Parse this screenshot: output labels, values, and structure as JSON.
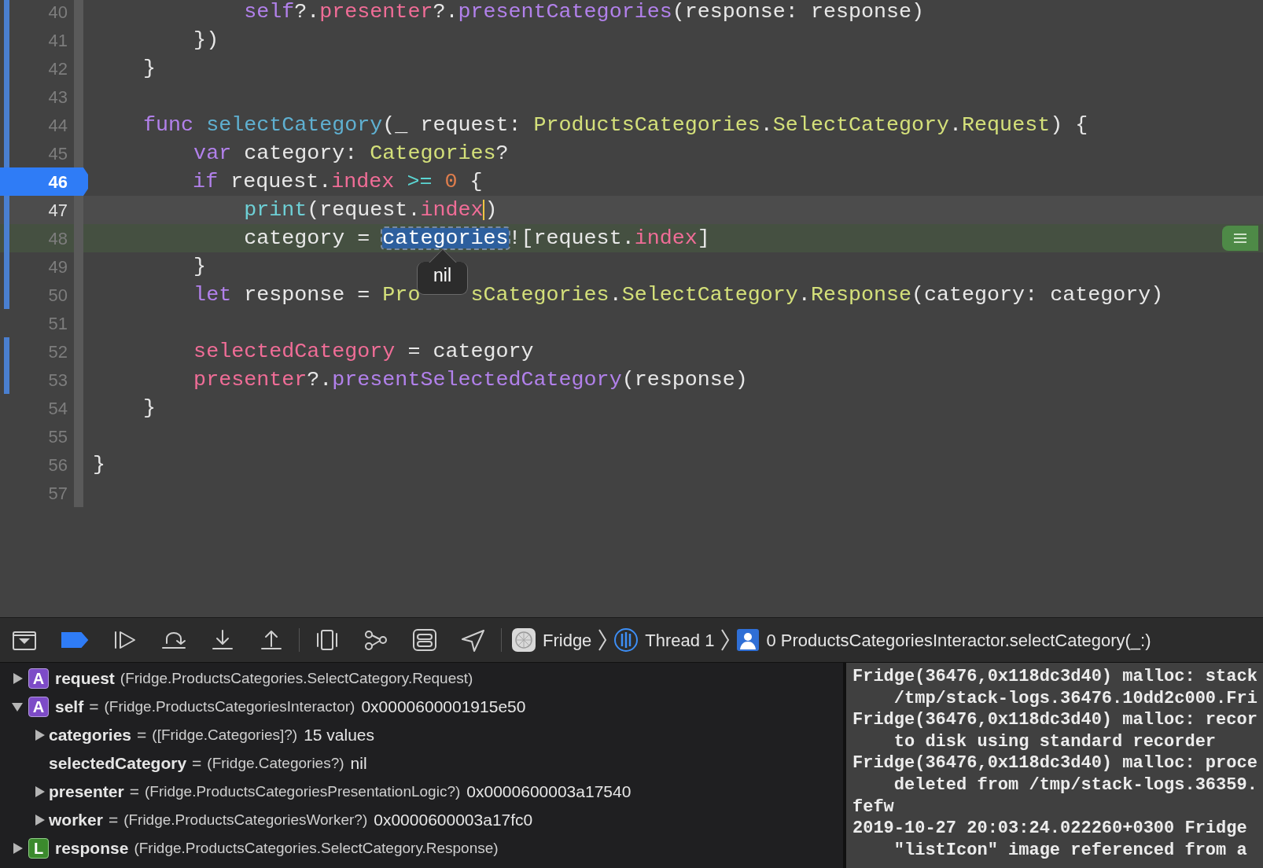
{
  "editor": {
    "lines": [
      {
        "number": "40",
        "kind": "normal",
        "changed": true,
        "tokens": [
          {
            "text": "            self",
            "kind": "keyword"
          },
          {
            "text": "?.",
            "kind": "plain"
          },
          {
            "text": "presenter",
            "kind": "prop"
          },
          {
            "text": "?.",
            "kind": "plain"
          },
          {
            "text": "presentCategories",
            "kind": "method"
          },
          {
            "text": "(response: response)",
            "kind": "plain"
          }
        ]
      },
      {
        "number": "41",
        "kind": "normal",
        "changed": true,
        "tokens": [
          {
            "text": "        })",
            "kind": "plain"
          }
        ]
      },
      {
        "number": "42",
        "kind": "normal",
        "changed": true,
        "tokens": [
          {
            "text": "    }",
            "kind": "plain"
          }
        ]
      },
      {
        "number": "43",
        "kind": "normal",
        "changed": true
      },
      {
        "number": "44",
        "kind": "normal",
        "changed": true,
        "tokens": [
          {
            "text": "    func ",
            "kind": "keyword"
          },
          {
            "text": "selectCategory",
            "kind": "decl"
          },
          {
            "text": "(_ request: ",
            "kind": "plain"
          },
          {
            "text": "ProductsCategories",
            "kind": "type"
          },
          {
            "text": ".",
            "kind": "plain"
          },
          {
            "text": "SelectCategory",
            "kind": "type"
          },
          {
            "text": ".",
            "kind": "plain"
          },
          {
            "text": "Request",
            "kind": "type"
          },
          {
            "text": ") {",
            "kind": "plain"
          }
        ]
      },
      {
        "number": "45",
        "kind": "normal",
        "changed": true,
        "tokens": [
          {
            "text": "        var",
            "kind": "keyword"
          },
          {
            "text": " category: ",
            "kind": "plain"
          },
          {
            "text": "Categories",
            "kind": "type"
          },
          {
            "text": "?",
            "kind": "plain"
          }
        ]
      },
      {
        "number": "46",
        "kind": "breakpoint",
        "tokens": [
          {
            "text": "        if",
            "kind": "keyword"
          },
          {
            "text": " request.",
            "kind": "plain"
          },
          {
            "text": "index",
            "kind": "prop"
          },
          {
            "text": " >= ",
            "kind": "operator"
          },
          {
            "text": "0",
            "kind": "number"
          },
          {
            "text": " {",
            "kind": "plain"
          }
        ]
      },
      {
        "number": "47",
        "kind": "cursor",
        "changed": true,
        "tokens": [
          {
            "text": "            print",
            "kind": "builtin"
          },
          {
            "text": "(request.",
            "kind": "plain"
          },
          {
            "text": "index",
            "kind": "prop-caret"
          },
          {
            "text": ")",
            "kind": "plain"
          }
        ]
      },
      {
        "number": "48",
        "kind": "current",
        "changed": true,
        "popover": "nil",
        "tokens": [
          {
            "text": "            category = ",
            "kind": "plain"
          },
          {
            "text": "categories",
            "kind": "selection"
          },
          {
            "text": "![request.",
            "kind": "plain"
          },
          {
            "text": "index",
            "kind": "prop"
          },
          {
            "text": "]",
            "kind": "plain"
          }
        ]
      },
      {
        "number": "49",
        "kind": "normal",
        "changed": true,
        "tokens": [
          {
            "text": "        }",
            "kind": "plain"
          }
        ]
      },
      {
        "number": "50",
        "kind": "normal",
        "changed": true,
        "tokens": [
          {
            "text": "        let",
            "kind": "keyword"
          },
          {
            "text": " response = ",
            "kind": "plain"
          },
          {
            "text": "Pro",
            "kind": "type-covered"
          },
          {
            "text": "sCategories",
            "kind": "type"
          },
          {
            "text": ".",
            "kind": "plain"
          },
          {
            "text": "SelectCategory",
            "kind": "type"
          },
          {
            "text": ".",
            "kind": "plain"
          },
          {
            "text": "Response",
            "kind": "type"
          },
          {
            "text": "(category: category)",
            "kind": "plain"
          }
        ]
      },
      {
        "number": "51",
        "kind": "normal",
        "changed": false
      },
      {
        "number": "52",
        "kind": "normal",
        "changed": true,
        "tokens": [
          {
            "text": "        selectedCategory",
            "kind": "prop"
          },
          {
            "text": " = category",
            "kind": "plain"
          }
        ]
      },
      {
        "number": "53",
        "kind": "normal",
        "changed": true,
        "tokens": [
          {
            "text": "        presenter",
            "kind": "prop"
          },
          {
            "text": "?.",
            "kind": "plain"
          },
          {
            "text": "presentSelectedCategory",
            "kind": "method"
          },
          {
            "text": "(response)",
            "kind": "plain"
          }
        ]
      },
      {
        "number": "54",
        "kind": "normal",
        "changed": false,
        "tokens": [
          {
            "text": "    }",
            "kind": "plain"
          }
        ]
      },
      {
        "number": "55",
        "kind": "normal",
        "changed": false
      },
      {
        "number": "56",
        "kind": "normal",
        "changed": false,
        "tokens": [
          {
            "text": "}",
            "kind": "plain"
          }
        ]
      },
      {
        "number": "57",
        "kind": "normal",
        "changed": false
      }
    ]
  },
  "debug_bar": {
    "breakpoints_active": true,
    "breadcrumbs": [
      {
        "kind": "app",
        "label": "Fridge"
      },
      {
        "kind": "thread",
        "label": "Thread 1"
      },
      {
        "kind": "frame",
        "label": "0 ProductsCategoriesInteractor.selectCategory(_:)"
      }
    ]
  },
  "variables": [
    {
      "badge": "A",
      "name": "request",
      "type": "(Fridge.ProductsCategories.SelectCategory.Request)",
      "expandable": true,
      "expanded": false
    },
    {
      "badge": "A",
      "name": "self",
      "assign": "=",
      "type": "(Fridge.ProductsCategoriesInteractor)",
      "value": "0x0000600001915e50",
      "expandable": true,
      "expanded": true,
      "children": [
        {
          "name": "categories",
          "assign": "=",
          "type": "([Fridge.Categories]?)",
          "value": "15 values",
          "expandable": true,
          "expanded": false
        },
        {
          "name": "selectedCategory",
          "assign": "=",
          "type": "(Fridge.Categories?)",
          "value": "nil",
          "expandable": false
        },
        {
          "name": "presenter",
          "assign": "=",
          "type": "(Fridge.ProductsCategoriesPresentationLogic?)",
          "value": "0x0000600003a17540",
          "expandable": true,
          "expanded": false
        },
        {
          "name": "worker",
          "assign": "=",
          "type": "(Fridge.ProductsCategoriesWorker?)",
          "value": "0x0000600003a17fc0",
          "expandable": true,
          "expanded": false
        }
      ]
    },
    {
      "badge": "L",
      "name": "response",
      "type": "(Fridge.ProductsCategories.SelectCategory.Response)",
      "expandable": true,
      "expanded": false
    }
  ],
  "console": [
    "Fridge(36476,0x118dc3d40) malloc: stack",
    "    /tmp/stack-logs.36476.10dd2c000.Fri",
    "Fridge(36476,0x118dc3d40) malloc: recor",
    "    to disk using standard recorder",
    "Fridge(36476,0x118dc3d40) malloc: proce",
    "    deleted from /tmp/stack-logs.36359.",
    "fefw",
    "2019-10-27 20:03:24.022260+0300 Fridge",
    "    \"listIcon\" image referenced from a"
  ]
}
